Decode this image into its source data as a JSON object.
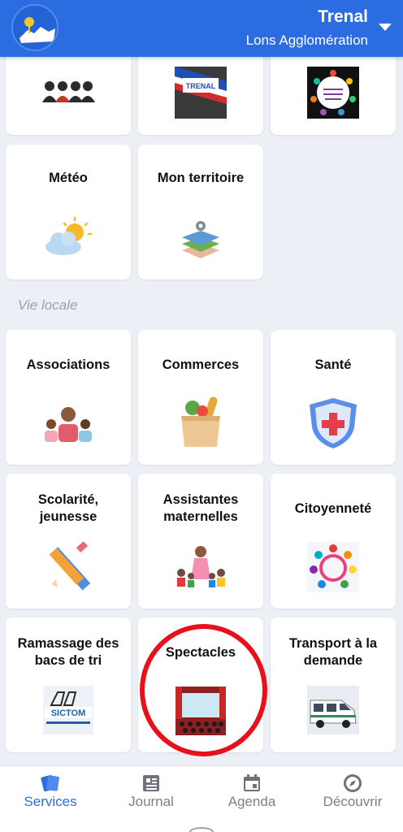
{
  "header": {
    "town": "Trenal",
    "agglomeration": "Lons Agglomération",
    "accent_color": "#2b6de0"
  },
  "top_tiles": [
    {
      "icon": "people-group-icon"
    },
    {
      "icon": "trenal-mayor-sash-icon",
      "image_text": "TRENAL"
    },
    {
      "icon": "youth-council-icon"
    }
  ],
  "tiles_upper": [
    {
      "label": "Météo",
      "icon": "sun-cloud-icon"
    },
    {
      "label": "Mon territoire",
      "icon": "map-layers-icon"
    }
  ],
  "section": {
    "title": "Vie locale"
  },
  "tiles_local": [
    {
      "label": "Associations",
      "icon": "people-icon"
    },
    {
      "label": "Commerces",
      "icon": "grocery-bag-icon"
    },
    {
      "label": "Santé",
      "icon": "health-shield-icon"
    },
    {
      "label": "Scolarité, jeunesse",
      "icon": "pencil-ruler-icon"
    },
    {
      "label": "Assistantes maternelles",
      "icon": "nanny-children-icon"
    },
    {
      "label": "Citoyenneté",
      "icon": "people-circle-icon"
    },
    {
      "label": "Ramassage des bacs de tri",
      "icon": "sictom-truck-icon",
      "image_text": "SICTOM"
    },
    {
      "label": "Spectacles",
      "icon": "theater-stage-icon"
    },
    {
      "label": "Transport à la demande",
      "icon": "minibus-icon"
    }
  ],
  "highlight": {
    "target": "Spectacles",
    "color": "#e8101a"
  },
  "bottom_nav": [
    {
      "label": "Services",
      "icon": "services-cards-icon",
      "active": true
    },
    {
      "label": "Journal",
      "icon": "newspaper-icon",
      "active": false
    },
    {
      "label": "Agenda",
      "icon": "calendar-icon",
      "active": false
    },
    {
      "label": "Découvrir",
      "icon": "compass-icon",
      "active": false
    }
  ]
}
